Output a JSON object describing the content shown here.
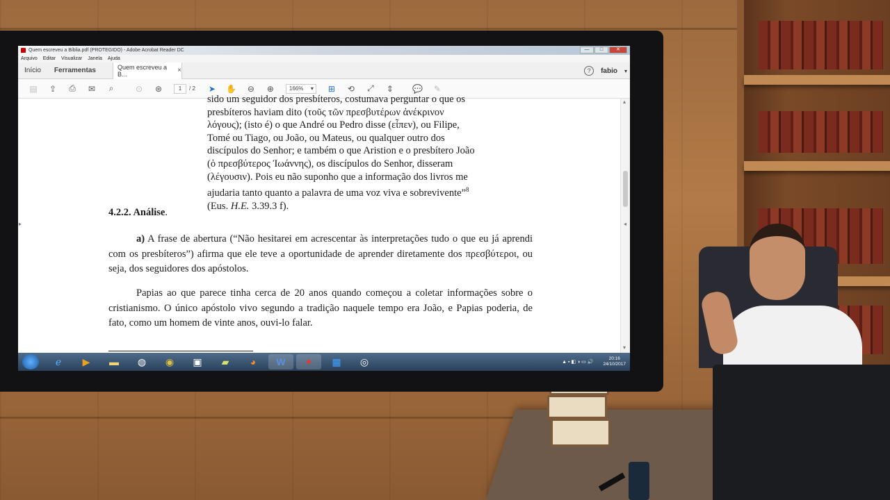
{
  "window": {
    "title": "Quem escreveu a Bíblia.pdf (PROTEGIDO) - Adobe Acrobat Reader DC",
    "min_label": "—",
    "max_label": "□",
    "close_label": "✕"
  },
  "menu": [
    "Arquivo",
    "Editar",
    "Visualizar",
    "Janela",
    "Ajuda"
  ],
  "tabs": {
    "home": "Início",
    "tools": "Ferramentas",
    "document": "Quem escreveu a B...",
    "close": "×"
  },
  "user": {
    "help": "?",
    "name": "fabio",
    "caret": "▾"
  },
  "toolbar": {
    "page_current": "1",
    "page_total": "/ 2",
    "zoom": "166%",
    "icons": [
      "save-icon",
      "upload-icon",
      "print-icon",
      "email-icon",
      "search-icon",
      "page-up-icon",
      "page-down-icon",
      "select-arrow-icon",
      "hand-icon",
      "zoom-out-icon",
      "zoom-in-icon",
      "fit-page-icon",
      "rotate-icon",
      "fullscreen-icon",
      "scroll-mode-icon",
      "comment-icon",
      "pen-icon"
    ]
  },
  "document": {
    "quote_lines": [
      "sido um seguidor dos presbíteros, costumava perguntar o que os",
      "presbíteros haviam dito (τοῦς τῶν πρεσβυτέρων ἀνέκρινον",
      "λόγους); (isto é) o que André ou Pedro disse (εἶπεν), ou Filipe,",
      "Tomé ou Tiago, ou João, ou Mateus, ou qualquer outro dos",
      "discípulos do Senhor; e também o que Aristion e o presbítero João",
      "(ὁ πρεσβύτερος Ἰωάννης), os discípulos do Senhor, disseram",
      "(λέγουσιν). Pois eu não suponho que a informação dos livros me",
      "ajudaria tanto quanto a palavra de uma voz viva e sobrevivente”"
    ],
    "quote_footnote": "8",
    "quote_citation_prefix": "(Eus. ",
    "quote_citation_work": "H.E.",
    "quote_citation_suffix": " 3.39.3 f).",
    "heading_number": "4.2.2. Análise",
    "heading_rest": ".",
    "para1_label": "a)",
    "para1_text": " A frase de abertura (“Não hesitarei em acrescentar às interpretações tudo o que eu já aprendi com os presbíteros”) afirma que ele teve a oportunidade de aprender diretamente dos πρεσβύτεροι, ou seja, dos seguidores dos apóstolos.",
    "para2_text": "Papias ao que parece tinha cerca de 20 anos quando começou a coletar informações sobre o cristianismo. O único apóstolo vivo segundo a tradição naquele tempo era João, e Papias poderia, de fato, como um homem de vinte anos, ouvi-lo falar."
  },
  "taskbar": {
    "apps": [
      "start-orb",
      "internet-explorer",
      "media-player",
      "file-explorer",
      "network",
      "chrome",
      "screen-capture",
      "folder",
      "firefox",
      "word",
      "acrobat-reader",
      "windows-store",
      "globe"
    ],
    "tray": "▲  ▪  ◧  ◑  ▭  🔊",
    "time": "20:16",
    "date": "24/10/2017"
  },
  "colors": {
    "accent": "#1f6fd1",
    "taskbar": "#2a415b",
    "close": "#c8453a"
  }
}
